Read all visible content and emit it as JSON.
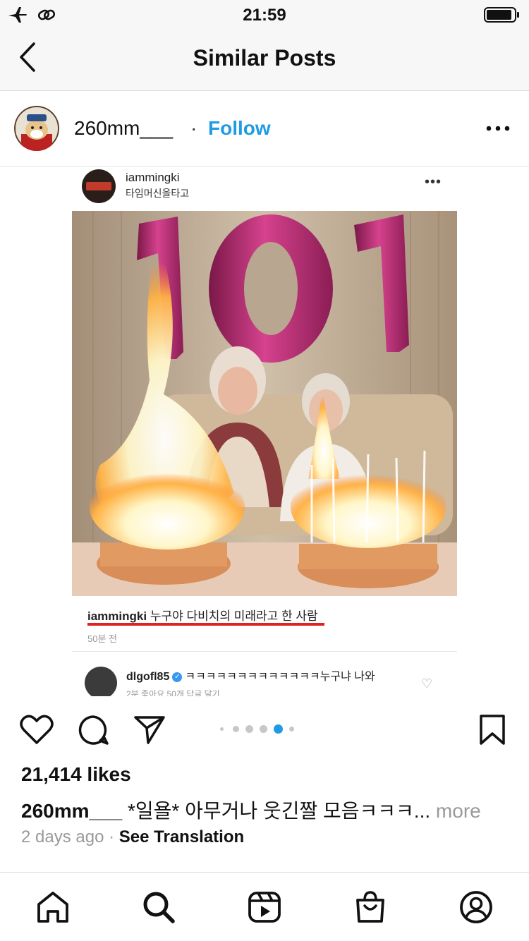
{
  "status_bar": {
    "time": "21:59"
  },
  "nav": {
    "title": "Similar Posts"
  },
  "post": {
    "username": "260mm___",
    "separator": "·",
    "follow_label": "Follow",
    "likes": "21,414 likes",
    "caption_user": "260mm___",
    "caption_text": "*일욜* 아무거나 웃긴짤 모음ㅋㅋㅋ...",
    "caption_more": "more",
    "time": "2 days ago",
    "time_sep": "·",
    "see_translation": "See Translation",
    "carousel": {
      "count": 6,
      "active_index": 4
    }
  },
  "embedded": {
    "username": "iammingki",
    "location": "타임머신을타고",
    "caption_user": "iammingki",
    "caption_text": "누구야 다비치의 미래라고 한 사람",
    "caption_time": "50분 전",
    "comment_user": "dlgofl85",
    "comment_text": "ㅋㅋㅋㅋㅋㅋㅋㅋㅋㅋㅋㅋㅋ누구냐 나와",
    "comment_meta": "2분    좋아요 50개    답글 달기",
    "balloons": "101"
  },
  "icons": {
    "status": [
      "airplane-icon",
      "link-icon",
      "battery-icon"
    ],
    "nav": [
      "back-chevron-icon"
    ],
    "actions": [
      "heart-icon",
      "comment-icon",
      "share-icon",
      "bookmark-icon"
    ],
    "tabbar": [
      "home-icon",
      "search-icon",
      "reels-icon",
      "shop-icon",
      "profile-icon"
    ]
  },
  "colors": {
    "accent": "#1f9be6",
    "carousel_active": "#1f9be6",
    "balloon": "#c2307a"
  }
}
